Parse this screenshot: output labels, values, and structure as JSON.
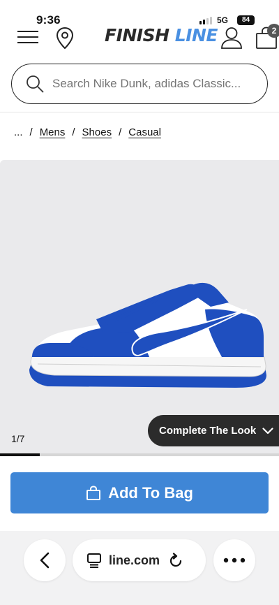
{
  "status": {
    "time": "9:36",
    "network": "5G",
    "battery": "84"
  },
  "header": {
    "brand_part1": "FINISH",
    "brand_part2": "LINE",
    "cart_count": "2"
  },
  "search": {
    "placeholder": "Search Nike Dunk, adidas Classic..."
  },
  "breadcrumb": {
    "ellipsis": "...",
    "items": [
      "Mens",
      "Shoes",
      "Casual"
    ],
    "separator": "/"
  },
  "gallery": {
    "counter": "1/7",
    "complete_look_label": "Complete The Look",
    "progress": 0.143
  },
  "actions": {
    "add_to_bag_label": "Add To Bag"
  },
  "browser": {
    "url": "line.com"
  },
  "colors": {
    "brand_blue": "#4a90e2",
    "button_blue": "#3f86d6",
    "shoe_blue": "#1f4fbf"
  },
  "icons": [
    "menu-icon",
    "location-pin-icon",
    "account-icon",
    "cart-icon",
    "search-icon",
    "chevron-down-icon",
    "bag-icon",
    "back-icon",
    "reader-icon",
    "reload-icon",
    "more-icon"
  ]
}
